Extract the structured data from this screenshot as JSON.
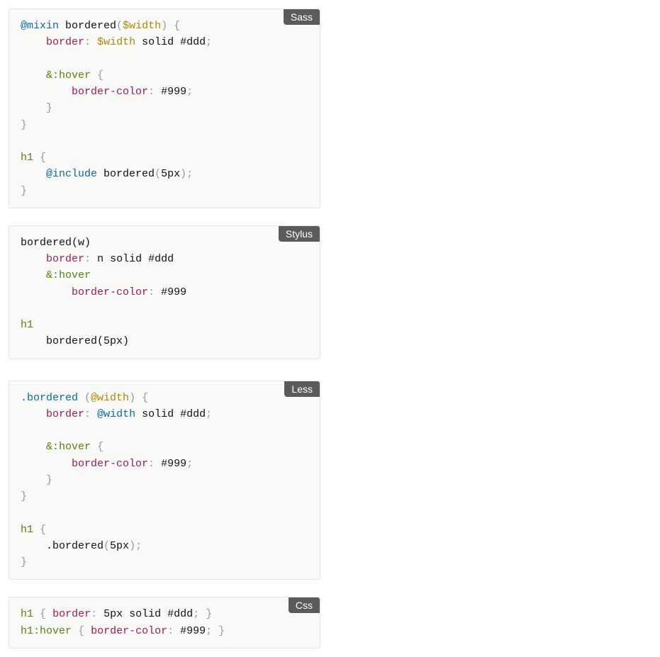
{
  "langs": {
    "sass": "Sass",
    "less": "Less",
    "stylus": "Stylus",
    "css": "Css"
  },
  "sass": {
    "l1_mixin": "@mixin",
    "l1_name": "bordered",
    "l1_open": "(",
    "l1_var": "$width",
    "l1_close": ")",
    "l1_brace": "{",
    "l2_prop": "border",
    "l2_colon": ":",
    "l2_var": "$width",
    "l2_solid": "solid",
    "l2_hex": "#ddd",
    "l2_semi": ";",
    "l4_hover": "&:hover",
    "l4_brace": "{",
    "l5_prop": "border-color",
    "l5_colon": ":",
    "l5_hex": "#999",
    "l5_semi": ";",
    "l6_brace": "}",
    "l7_brace": "}",
    "l9_sel": "h1",
    "l9_brace": "{",
    "l10_include": "@include",
    "l10_name": "bordered",
    "l10_open": "(",
    "l10_arg": "5px",
    "l10_close": ")",
    "l10_semi": ";",
    "l11_brace": "}"
  },
  "less": {
    "l1_class": ".bordered",
    "l1_open": "(",
    "l1_var": "@width",
    "l1_close": ")",
    "l1_brace": "{",
    "l2_prop": "border",
    "l2_colon": ":",
    "l2_var": "@width",
    "l2_solid": "solid",
    "l2_hex": "#ddd",
    "l2_semi": ";",
    "l4_hover": "&:hover",
    "l4_brace": "{",
    "l5_prop": "border-color",
    "l5_colon": ":",
    "l5_hex": "#999",
    "l5_semi": ";",
    "l6_brace": "}",
    "l7_brace": "}",
    "l9_sel": "h1",
    "l9_brace": "{",
    "l10_call": ".bordered",
    "l10_open": "(",
    "l10_arg": "5px",
    "l10_close": ")",
    "l10_semi": ";",
    "l11_brace": "}"
  },
  "stylus": {
    "l1_name": "bordered(w)",
    "l2_prop": "border",
    "l2_colon": ":",
    "l2_n": "n",
    "l2_solid": "solid",
    "l2_hex": "#ddd",
    "l3_hover": "&:hover",
    "l4_prop": "border-color",
    "l4_colon": ":",
    "l4_hex": "#999",
    "l6_sel": "h1",
    "l7_call": "bordered(",
    "l7_arg": "5px",
    "l7_close": ")"
  },
  "css": {
    "l1_sel": "h1",
    "l1_open": "{",
    "l1_prop": "border",
    "l1_colon": ":",
    "l1_val5": "5px",
    "l1_solid": "solid",
    "l1_hex": "#ddd",
    "l1_semi": ";",
    "l1_close": "}",
    "l2_sel": "h1:hover",
    "l2_open": "{",
    "l2_prop": "border-color",
    "l2_colon": ":",
    "l2_hex": "#999",
    "l2_semi": ";",
    "l2_close": "}"
  }
}
